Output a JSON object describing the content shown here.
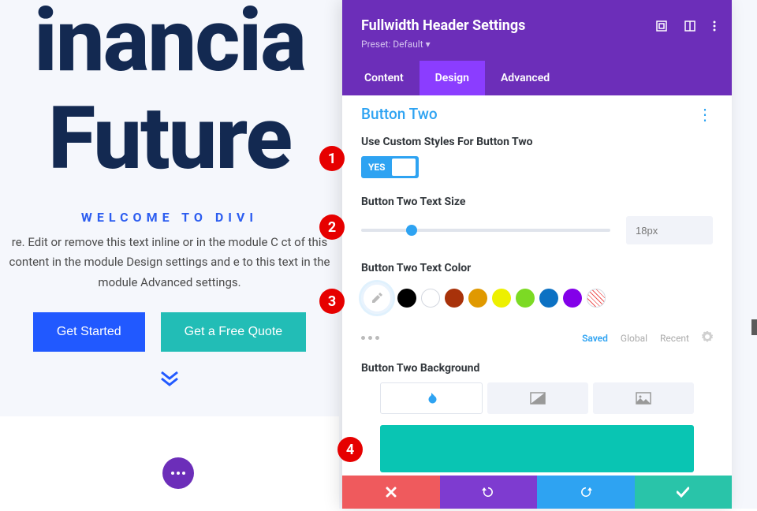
{
  "page": {
    "title_line1": "inancia",
    "title_line2": "Future",
    "subtitle": "Welcome to Divi",
    "body": "re. Edit or remove this text inline or in the module C ct of this content in the module Design settings and e to this text in the module Advanced settings.",
    "btn_primary": "Get Started",
    "btn_secondary": "Get a Free Quote"
  },
  "panel": {
    "title": "Fullwidth Header Settings",
    "preset": "Preset: Default",
    "tabs": [
      "Content",
      "Design",
      "Advanced"
    ],
    "active_tab": 1,
    "section_title": "Button Two",
    "fields": {
      "custom_styles": {
        "label": "Use Custom Styles For Button Two",
        "toggle_label": "YES",
        "value": true
      },
      "text_size": {
        "label": "Button Two Text Size",
        "value": "18px",
        "slider_pct": 18
      },
      "text_color": {
        "label": "Button Two Text Color",
        "swatches": [
          {
            "name": "black",
            "hex": "#000000"
          },
          {
            "name": "white",
            "hex": "#ffffff",
            "bordered": true
          },
          {
            "name": "dark-red",
            "hex": "#a8320a"
          },
          {
            "name": "orange",
            "hex": "#e09900"
          },
          {
            "name": "yellow",
            "hex": "#edf000"
          },
          {
            "name": "green",
            "hex": "#7cda24"
          },
          {
            "name": "blue",
            "hex": "#0c71c3"
          },
          {
            "name": "purple",
            "hex": "#8300e9"
          },
          {
            "name": "transparent",
            "striped": true
          }
        ],
        "states": [
          "Saved",
          "Global",
          "Recent"
        ],
        "active_state": 0
      },
      "background": {
        "label": "Button Two Background",
        "preview_color": "#09c5b3"
      }
    }
  },
  "callouts": [
    "1",
    "2",
    "3",
    "4"
  ]
}
